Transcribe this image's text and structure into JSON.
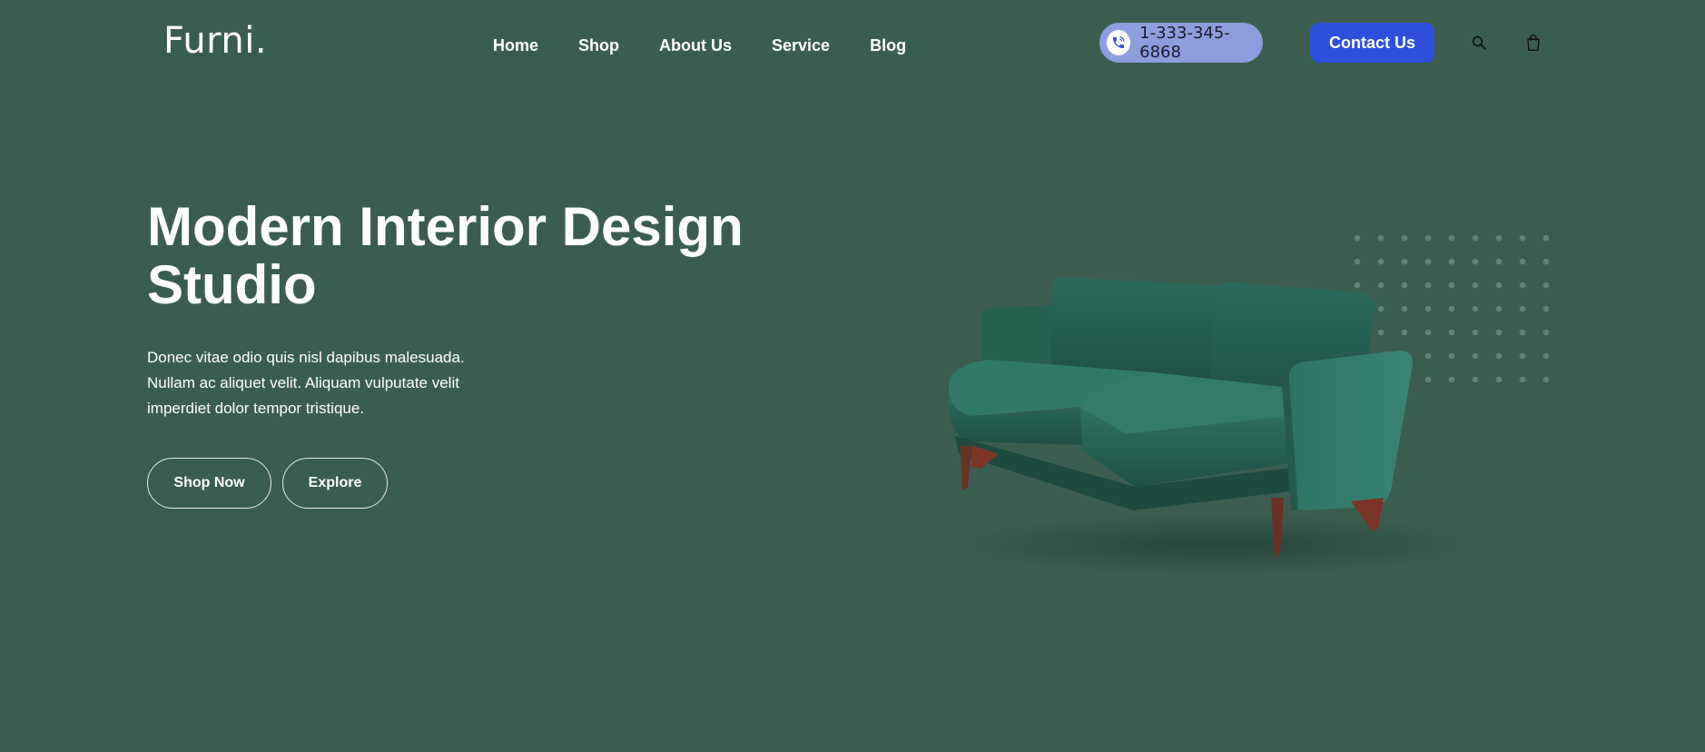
{
  "brand": {
    "logo": "Furni."
  },
  "nav": {
    "items": [
      {
        "label": "Home"
      },
      {
        "label": "Shop"
      },
      {
        "label": "About Us"
      },
      {
        "label": "Service"
      },
      {
        "label": "Blog"
      }
    ]
  },
  "header": {
    "phone": "1-333-345-6868",
    "contact_label": "Contact Us",
    "icons": {
      "phone": "phone-icon",
      "search": "search-icon",
      "cart": "shopping-bag-icon"
    }
  },
  "hero": {
    "title": "Modern Interior Design Studio",
    "description": "Donec vitae odio quis nisl dapibus malesuada. Nullam ac aliquet velit. Aliquam vulputate velit imperdiet dolor tempor tristique.",
    "primary_cta": "Shop Now",
    "secondary_cta": "Explore",
    "image": "green-velvet-sofa"
  },
  "colors": {
    "background": "#3b5d50",
    "accent": "#2f4fdc",
    "phone_pill": "#8e9ddd",
    "sofa": "#2e6b5c"
  }
}
